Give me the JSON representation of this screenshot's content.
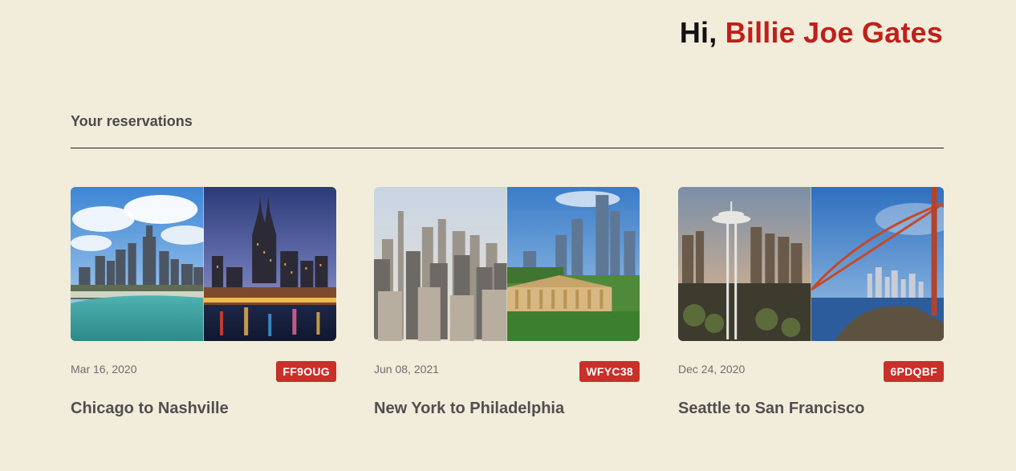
{
  "header": {
    "greeting_prefix": "Hi,",
    "user_name": "Billie Joe Gates"
  },
  "section": {
    "title": "Your reservations"
  },
  "colors": {
    "accent": "#c0201a",
    "badge": "#c8302a",
    "background": "#f2ecdb"
  },
  "reservations": [
    {
      "date": "Mar 16, 2020",
      "code": "FF9OUG",
      "route": "Chicago to Nashville",
      "image_left": "chicago-skyline-photo",
      "image_right": "nashville-skyline-photo"
    },
    {
      "date": "Jun 08, 2021",
      "code": "WFYC38",
      "route": "New York to Philadelphia",
      "image_left": "new-york-skyline-photo",
      "image_right": "philadelphia-skyline-photo"
    },
    {
      "date": "Dec 24, 2020",
      "code": "6PDQBF",
      "route": "Seattle to San Francisco",
      "image_left": "seattle-space-needle-photo",
      "image_right": "san-francisco-golden-gate-photo"
    }
  ]
}
